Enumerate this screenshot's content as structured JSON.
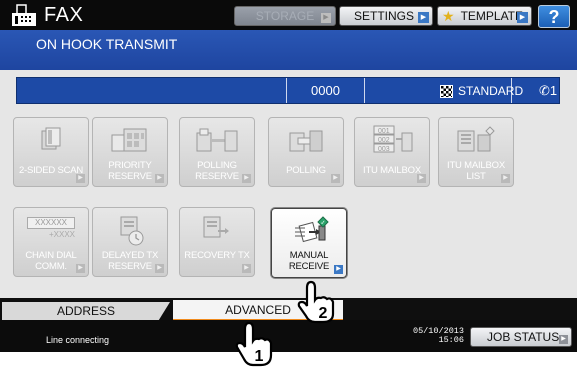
{
  "header": {
    "app_title": "FAX",
    "mode_title": "ON HOOK TRANSMIT",
    "storage_label": "STORAGE",
    "settings_label": "SETTINGS",
    "template_label": "TEMPLATE",
    "help_label": "?"
  },
  "status": {
    "count": "0000",
    "resolution": "STANDARD",
    "line": "1"
  },
  "functions": [
    {
      "label": "2-SIDED SCAN",
      "icon": "two-sided-scan-icon",
      "enabled": false
    },
    {
      "label": "PRIORITY RESERVE",
      "icon": "priority-reserve-icon",
      "enabled": false
    },
    {
      "label": "POLLING RESERVE",
      "icon": "polling-reserve-icon",
      "enabled": false
    },
    {
      "label": "POLLING",
      "icon": "polling-icon",
      "enabled": false
    },
    {
      "label": "ITU MAILBOX",
      "icon": "itu-mailbox-icon",
      "enabled": false
    },
    {
      "label": "ITU MAILBOX LIST",
      "icon": "itu-mailbox-list-icon",
      "enabled": false
    },
    {
      "label": "CHAIN DIAL COMM.",
      "icon": "chain-dial-icon",
      "enabled": false,
      "icon_text_top": "XXXXXX",
      "icon_text_bottom": "+XXXX"
    },
    {
      "label": "DELAYED TX RESERVE",
      "icon": "delayed-tx-icon",
      "enabled": false
    },
    {
      "label": "RECOVERY TX",
      "icon": "recovery-tx-icon",
      "enabled": false
    },
    {
      "label": "MANUAL RECEIVE",
      "icon": "manual-receive-icon",
      "enabled": true
    }
  ],
  "itu_mailbox_icon": {
    "top": "001",
    "mid": "002",
    "bottom": "003"
  },
  "tabs": {
    "address": "ADDRESS",
    "advanced": "ADVANCED"
  },
  "footer": {
    "status_text": "Line connecting",
    "date": "05/10/2013",
    "time": "15:06",
    "job_status_label": "JOB STATUS"
  },
  "callouts": [
    "1",
    "2"
  ],
  "colors": {
    "header_blue": "#2a57b5",
    "status_blue": "#1d4aa6",
    "active_tab_accent": "#f08a1c",
    "arrow_blue": "#3b78c4",
    "template_star": "#e3b21c"
  }
}
